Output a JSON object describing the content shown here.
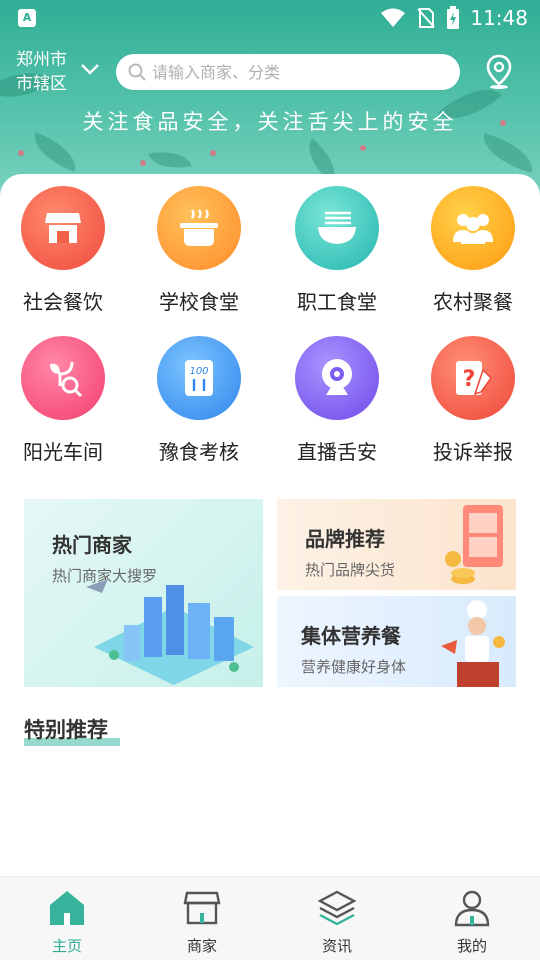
{
  "status_bar": {
    "app_badge": "A",
    "time": "11:48"
  },
  "header": {
    "city_line1": "郑州市",
    "city_line2": "市辖区",
    "search_placeholder": "请输入商家、分类",
    "slogan": "关注食品安全，关注舌尖上的安全"
  },
  "categories": [
    {
      "label": "社会餐饮",
      "icon": "storefront-icon",
      "color": "#f4604e"
    },
    {
      "label": "学校食堂",
      "icon": "cooking-pot-icon",
      "color": "#ffa53a"
    },
    {
      "label": "职工食堂",
      "icon": "noodle-bowl-icon",
      "color": "#3fcfc1"
    },
    {
      "label": "农村聚餐",
      "icon": "people-group-icon",
      "color": "#ffb21c"
    },
    {
      "label": "阳光车间",
      "icon": "plant-search-icon",
      "color": "#f95b86"
    },
    {
      "label": "豫食考核",
      "icon": "checklist-icon",
      "color": "#3d9ff0"
    },
    {
      "label": "直播舌安",
      "icon": "webcam-icon",
      "color": "#8b6cf0"
    },
    {
      "label": "投诉举报",
      "icon": "report-icon",
      "color": "#f66558"
    }
  ],
  "promos": {
    "hot": {
      "title": "热门商家",
      "subtitle": "热门商家大搜罗"
    },
    "brand": {
      "title": "品牌推荐",
      "subtitle": "热门品牌尖货"
    },
    "meal": {
      "title": "集体营养餐",
      "subtitle": "营养健康好身体"
    }
  },
  "section": {
    "title": "特别推荐"
  },
  "tabs": [
    {
      "label": "主页",
      "icon": "home-icon",
      "active": true
    },
    {
      "label": "商家",
      "icon": "shop-icon",
      "active": false
    },
    {
      "label": "资讯",
      "icon": "layers-icon",
      "active": false
    },
    {
      "label": "我的",
      "icon": "user-icon",
      "active": false
    }
  ],
  "colors": {
    "accent": "#2fae95",
    "header": "#55c3ab"
  }
}
